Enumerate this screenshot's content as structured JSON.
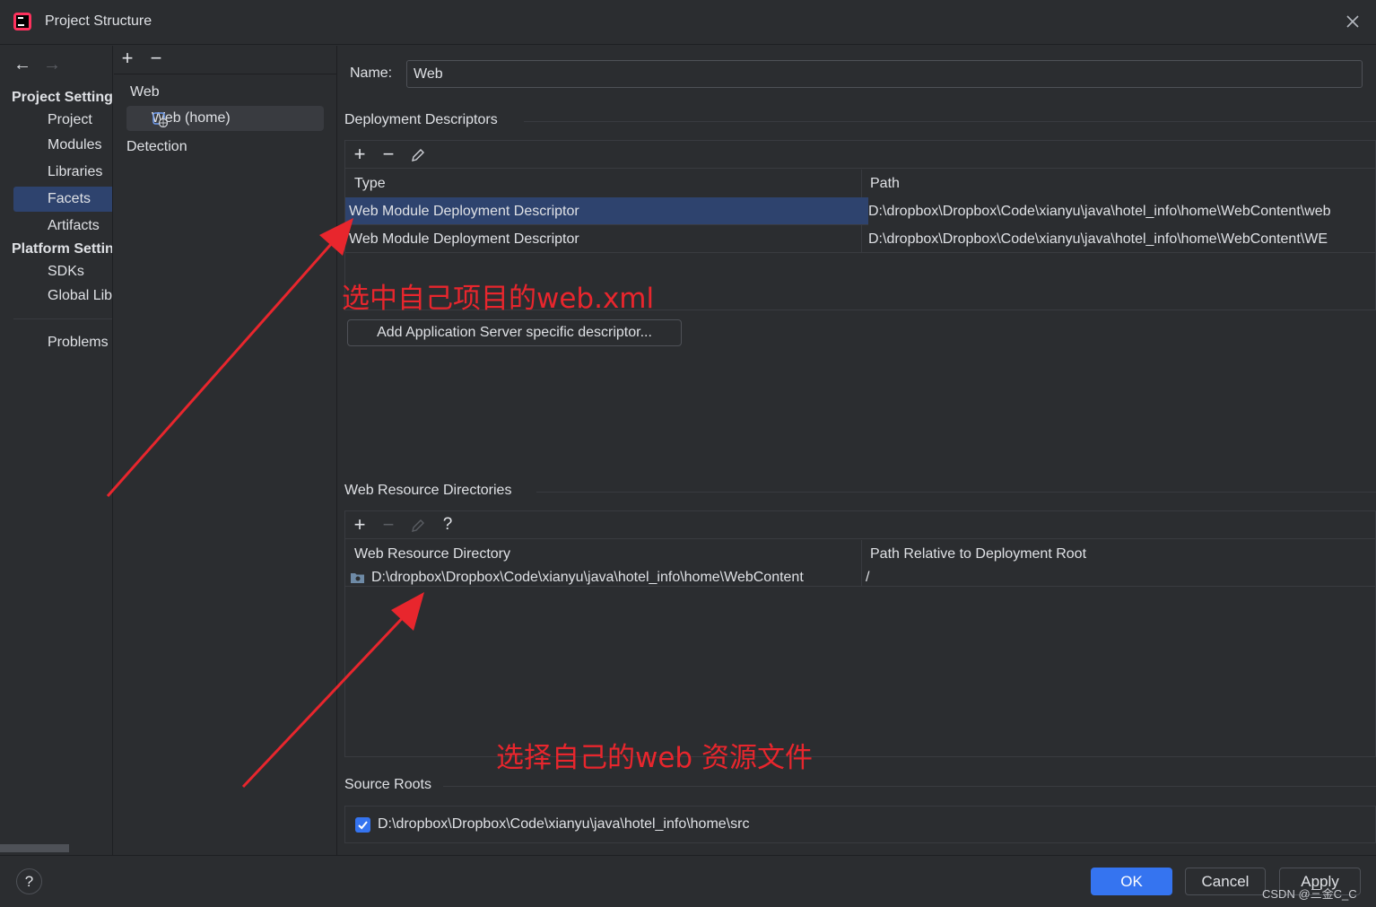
{
  "window": {
    "title": "Project Structure"
  },
  "nav": {
    "project_settings_header": "Project Settings",
    "platform_settings_header": "Platform Settings",
    "items": [
      {
        "label": "Project"
      },
      {
        "label": "Modules"
      },
      {
        "label": "Libraries"
      },
      {
        "label": "Facets"
      },
      {
        "label": "Artifacts"
      },
      {
        "label": "SDKs"
      },
      {
        "label": "Global Libraries"
      },
      {
        "label": "Problems"
      }
    ],
    "selected": "Facets"
  },
  "tree": {
    "group": "Web",
    "item": "Web (home)",
    "detection": "Detection"
  },
  "form": {
    "name_label": "Name:",
    "name_value": "Web"
  },
  "deployment": {
    "title": "Deployment Descriptors",
    "col_type": "Type",
    "col_path": "Path",
    "rows": [
      {
        "type": "Web Module Deployment Descriptor",
        "path": "D:\\dropbox\\Dropbox\\Code\\xianyu\\java\\hotel_info\\home\\WebContent\\web"
      },
      {
        "type": "Web Module Deployment Descriptor",
        "path": "D:\\dropbox\\Dropbox\\Code\\xianyu\\java\\hotel_info\\home\\WebContent\\WE"
      }
    ],
    "add_server_button": "Add Application Server specific descriptor..."
  },
  "web_resources": {
    "title": "Web Resource Directories",
    "col_dir": "Web Resource Directory",
    "col_rel": "Path Relative to Deployment Root",
    "rows": [
      {
        "dir": "D:\\dropbox\\Dropbox\\Code\\xianyu\\java\\hotel_info\\home\\WebContent",
        "rel": "/"
      }
    ],
    "help_glyph": "?"
  },
  "source_roots": {
    "title": "Source Roots",
    "items": [
      {
        "path": "D:\\dropbox\\Dropbox\\Code\\xianyu\\java\\hotel_info\\home\\src",
        "checked": true
      }
    ]
  },
  "footer": {
    "ok": "OK",
    "cancel": "Cancel",
    "apply": "Apply",
    "help_glyph": "?",
    "watermark": "CSDN @三金C_C"
  },
  "annotations": {
    "note1": "选中自己项目的web.xml",
    "note2": "选择自己的web 资源文件"
  },
  "colors": {
    "background": "#2b2d30",
    "selection": "#2e436e",
    "accent": "#3574f0",
    "annotation": "#e8262d"
  }
}
